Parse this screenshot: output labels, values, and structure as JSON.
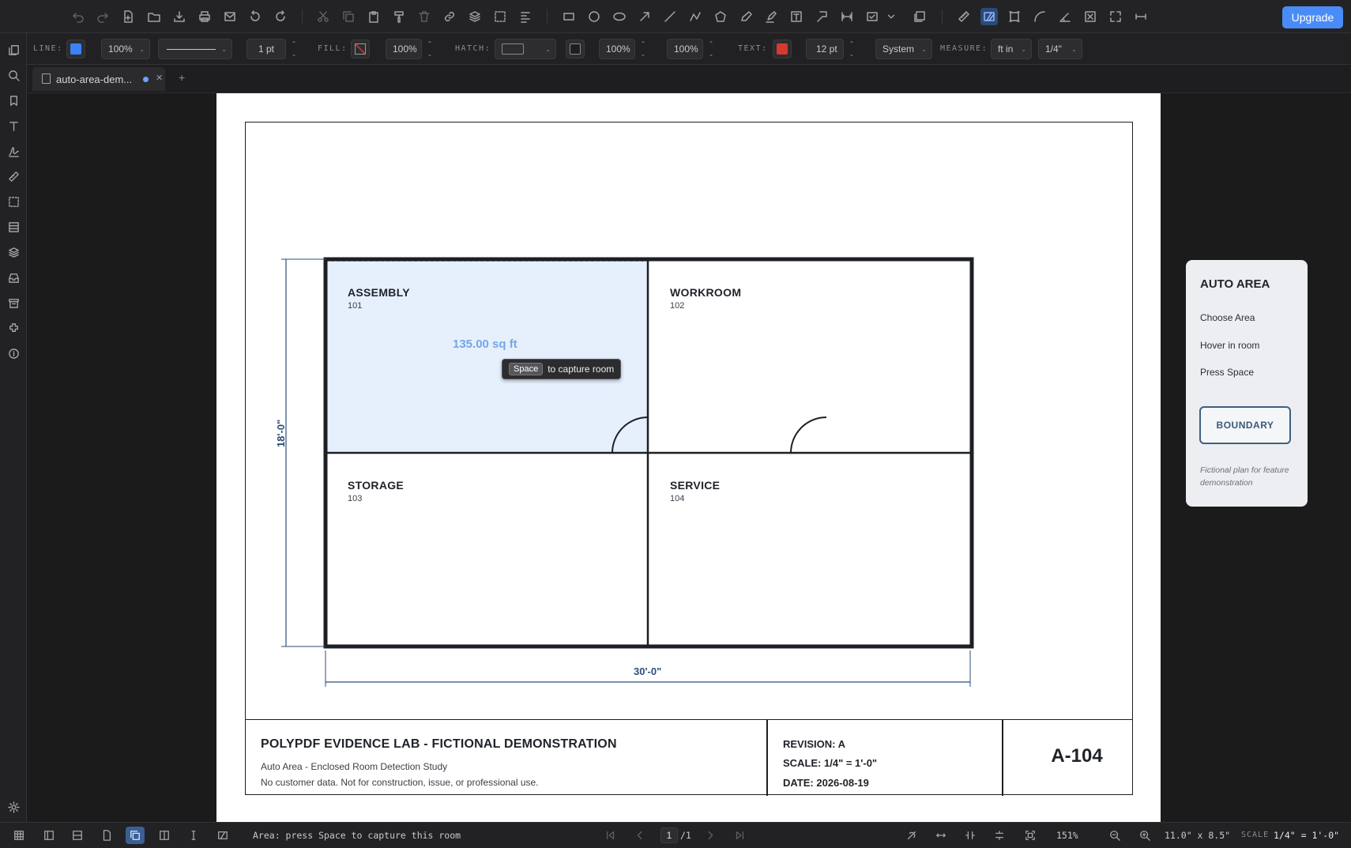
{
  "toolbar": {
    "upgrade_label": "Upgrade"
  },
  "properties": {
    "line_label": "LINE:",
    "line_color": "#3b82f6",
    "line_opacity": "100%",
    "line_width": "1 pt",
    "fill_label": "FILL:",
    "fill_opacity": "100%",
    "hatch_label": "HATCH:",
    "hatch_opacity_1": "100%",
    "hatch_opacity_2": "100%",
    "text_label": "TEXT:",
    "text_color": "#d63a2f",
    "text_size": "12 pt",
    "font": "System",
    "measure_label": "MEASURE:",
    "measure_unit": "ft in",
    "measure_scale": "1/4\""
  },
  "tabs": [
    {
      "label": "auto-area-dem...",
      "modified": true
    }
  ],
  "drawing": {
    "rooms": [
      {
        "name": "ASSEMBLY",
        "number": "101"
      },
      {
        "name": "WORKROOM",
        "number": "102"
      },
      {
        "name": "STORAGE",
        "number": "103"
      },
      {
        "name": "SERVICE",
        "number": "104"
      }
    ],
    "area_measurement": "135.00 sq ft",
    "tooltip_key": "Space",
    "tooltip_text": "to capture room",
    "dim_vertical": "18'-0\"",
    "dim_horizontal": "30'-0\"",
    "highlight_color": "#e6f0fd"
  },
  "panel": {
    "title": "AUTO AREA",
    "steps": [
      "Choose Area",
      "Hover in room",
      "Press Space"
    ],
    "button_label": "BOUNDARY",
    "note": "Fictional plan for feature demonstration"
  },
  "titleblock": {
    "title": "POLYPDF EVIDENCE LAB - FICTIONAL DEMONSTRATION",
    "subtitle": "Auto Area - Enclosed Room Detection Study",
    "disclaimer": "No customer data. Not for construction, issue, or professional use.",
    "revision": "REVISION: A",
    "scale": "SCALE: 1/4\" = 1'-0\"",
    "date": "DATE: 2026-08-19",
    "sheet": "A-104"
  },
  "status": {
    "message": "Area: press Space to capture this room",
    "page_current": "1",
    "page_total": "/1",
    "zoom": "151%",
    "page_size": "11.0\" x 8.5\"",
    "scale_label": "SCALE",
    "scale_value": "1/4\" = 1'-0\""
  }
}
